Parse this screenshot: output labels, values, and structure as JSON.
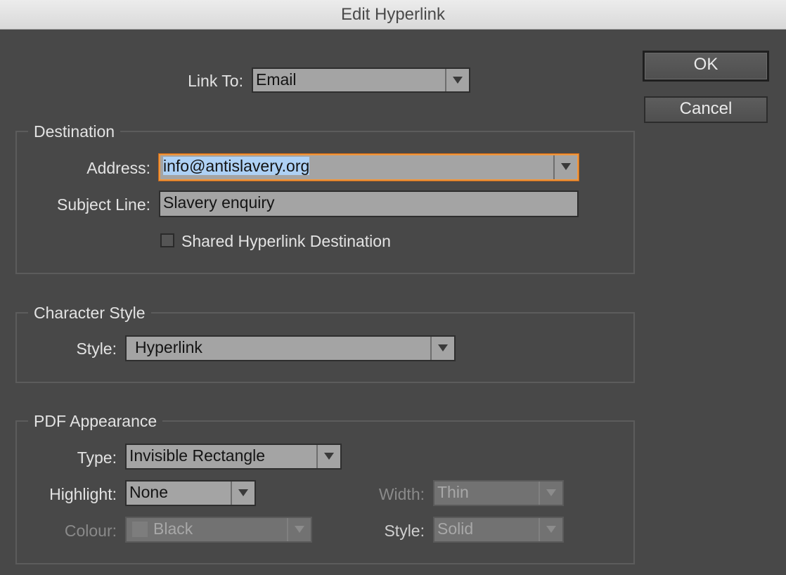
{
  "window": {
    "title": "Edit Hyperlink"
  },
  "link_to": {
    "label": "Link To:",
    "value": "Email"
  },
  "buttons": {
    "ok": "OK",
    "cancel": "Cancel"
  },
  "destination": {
    "legend": "Destination",
    "address_label": "Address:",
    "address_value": "info@antislavery.org",
    "subject_label": "Subject Line:",
    "subject_value": "Slavery enquiry",
    "shared_label": "Shared Hyperlink Destination",
    "shared_checked": false
  },
  "character_style": {
    "legend": "Character Style",
    "style_label": "Style:",
    "style_value": "Hyperlink"
  },
  "pdf_appearance": {
    "legend": "PDF Appearance",
    "type_label": "Type:",
    "type_value": "Invisible Rectangle",
    "highlight_label": "Highlight:",
    "highlight_value": "None",
    "colour_label": "Colour:",
    "colour_value": "Black",
    "width_label": "Width:",
    "width_value": "Thin",
    "style_label": "Style:",
    "style_value": "Solid"
  },
  "colors": {
    "focus_ring": "#f0963c",
    "selection": "#aed1f5",
    "background": "#484848"
  },
  "icons": {
    "dropdown": "chevron-down-icon",
    "swatch": "color-swatch-icon"
  }
}
